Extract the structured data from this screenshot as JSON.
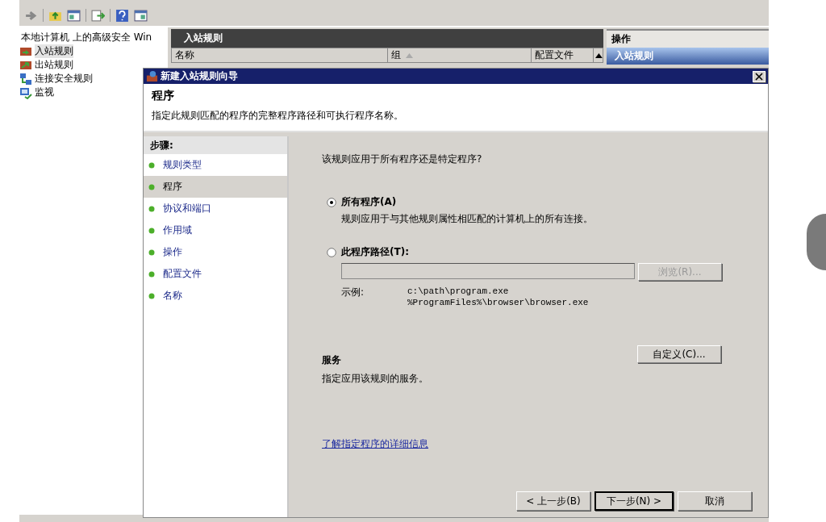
{
  "console": {
    "tree": {
      "root": "本地计算机 上的高级安全 Win",
      "items": [
        {
          "label": "入站规则",
          "kind": "inbound",
          "selected": true
        },
        {
          "label": "出站规则",
          "kind": "outbound",
          "selected": false
        },
        {
          "label": "连接安全规则",
          "kind": "connection",
          "selected": false
        },
        {
          "label": "监视",
          "kind": "monitor",
          "selected": false
        }
      ]
    },
    "rules_pane": {
      "title": "入站规则",
      "columns": [
        {
          "label": "名称",
          "sorted": false
        },
        {
          "label": "组",
          "sorted": true
        },
        {
          "label": "配置文件",
          "sorted": false
        }
      ]
    },
    "actions_pane": {
      "title": "操作",
      "items": [
        {
          "label": "入站规则",
          "selected": true
        }
      ]
    }
  },
  "dialog": {
    "title": "新建入站规则向导",
    "heading": "程序",
    "description": "指定此规则匹配的程序的完整程序路径和可执行程序名称。",
    "steps_title": "步骤:",
    "steps": [
      {
        "label": "规则类型",
        "selected": false
      },
      {
        "label": "程序",
        "selected": true
      },
      {
        "label": "协议和端口",
        "selected": false
      },
      {
        "label": "作用域",
        "selected": false
      },
      {
        "label": "操作",
        "selected": false
      },
      {
        "label": "配置文件",
        "selected": false
      },
      {
        "label": "名称",
        "selected": false
      }
    ],
    "question": "该规则应用于所有程序还是特定程序?",
    "options": [
      {
        "label": "所有程序(A)",
        "description": "规则应用于与其他规则属性相匹配的计算机上的所有连接。",
        "selected": true
      },
      {
        "label": "此程序路径(T):",
        "selected": false
      }
    ],
    "path_field": {
      "disabled": true
    },
    "browse_button": {
      "label": "浏览(R)...",
      "disabled": true
    },
    "example_label": "示例:",
    "examples": [
      "c:\\path\\program.exe",
      "%ProgramFiles%\\browser\\browser.exe"
    ],
    "services": {
      "title": "服务",
      "description": "指定应用该规则的服务。",
      "button": "自定义(C)..."
    },
    "link": "了解指定程序的详细信息",
    "buttons": [
      {
        "label": "< 上一步(B)",
        "default": false
      },
      {
        "label": "下一步(N) >",
        "default": true
      },
      {
        "label": "取消",
        "default": false
      }
    ]
  }
}
